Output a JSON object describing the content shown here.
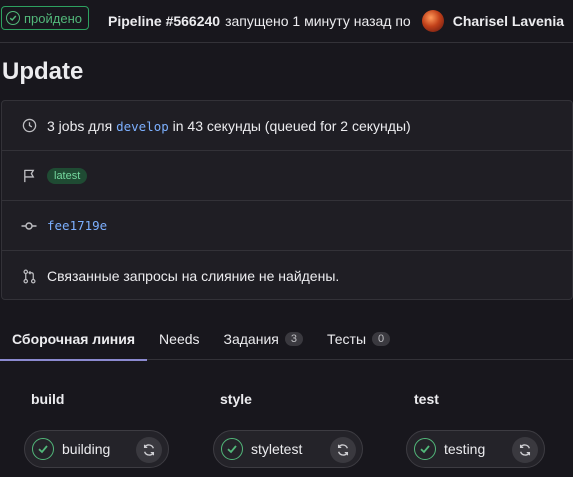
{
  "header": {
    "status_label": "пройдено",
    "pipeline_id": "Pipeline #566240",
    "started_text": "запущено 1 минуту назад по",
    "user_name": "Charisel Lavenia"
  },
  "page": {
    "title": "Update"
  },
  "info": {
    "jobs_count": "3 jobs для",
    "branch": "develop",
    "duration": "in 43 секунды (queued for 2 секунды)",
    "tag": "latest",
    "commit": "fee1719e",
    "merge_requests": "Связанные запросы на слияние не найдены."
  },
  "tabs": [
    {
      "label": "Сборочная линия",
      "active": true
    },
    {
      "label": "Needs"
    },
    {
      "label": "Задания",
      "count": "3"
    },
    {
      "label": "Тесты",
      "count": "0"
    }
  ],
  "stages": [
    {
      "title": "build",
      "job": "building"
    },
    {
      "title": "style",
      "job": "styletest"
    },
    {
      "title": "test",
      "job": "testing"
    }
  ],
  "icons": [
    "check-circle-icon",
    "avatar",
    "palette-icon",
    "clock-icon",
    "flag-icon",
    "commit-icon",
    "merge-request-icon",
    "retry-icon"
  ],
  "colors": {
    "success": "#52b87a",
    "link": "#7cb0ff",
    "background": "#18171d"
  }
}
